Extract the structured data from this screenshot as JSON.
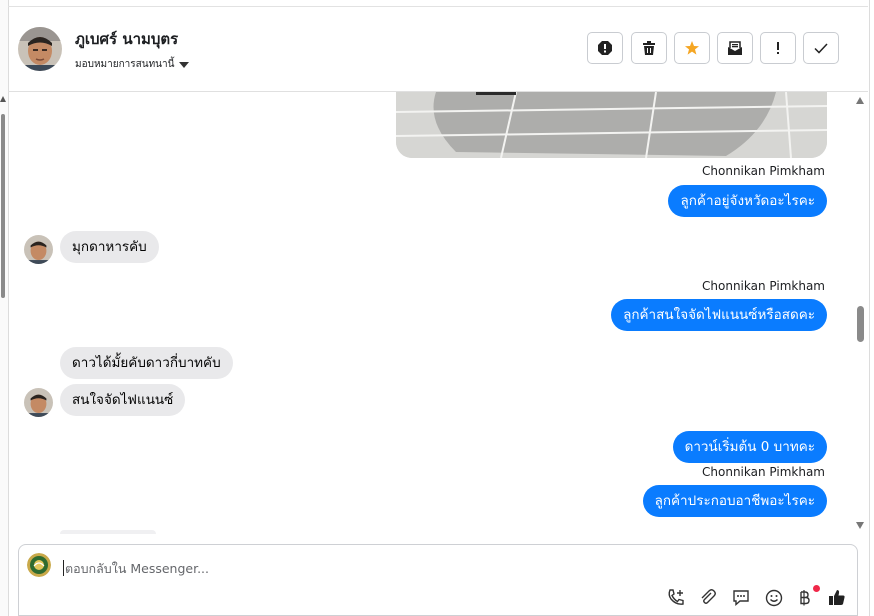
{
  "header": {
    "contact_name": "ภูเบศร์ นามบุตร",
    "assign_label": "มอบหมายการสนทนานี้"
  },
  "toolbar": {
    "buttons": [
      {
        "name": "report-icon"
      },
      {
        "name": "trash-icon"
      },
      {
        "name": "star-icon",
        "color": "#f5a623"
      },
      {
        "name": "mail-envelope-icon"
      },
      {
        "name": "exclamation-icon"
      },
      {
        "name": "checkmark-icon"
      }
    ]
  },
  "messages": [
    {
      "type": "image"
    },
    {
      "type": "outgoing",
      "sender": "Chonnikan Pimkham",
      "text": "ลูกค้าอยู่จังหวัดอะไรคะ"
    },
    {
      "type": "incoming",
      "text": "มุกดาหารคับ"
    },
    {
      "type": "outgoing",
      "sender": "Chonnikan Pimkham",
      "text": "ลูกค้าสนใจจัดไฟแนนซ์หรือสดคะ"
    },
    {
      "type": "incoming",
      "text": "ดาวได้มั้ยคับดาวกี่บาทคับ"
    },
    {
      "type": "incoming",
      "text": "สนใจจัดไฟแนนซ์"
    },
    {
      "type": "outgoing",
      "text": "ดาวน์เริ่มต้น 0 บาทคะ"
    },
    {
      "type": "outgoing",
      "sender": "Chonnikan Pimkham",
      "text": "ลูกค้าประกอบอาชีพอะไรคะ"
    }
  ],
  "composer": {
    "placeholder": "ตอบกลับใน Messenger...",
    "icons": [
      "phone-plus-icon",
      "paperclip-icon",
      "speech-bubble-icon",
      "emoji-icon",
      "baht-icon",
      "thumbs-up-icon"
    ],
    "notification_dot_color": "#f02849"
  },
  "colors": {
    "outgoing_bubble": "#0a7cff",
    "incoming_bubble": "#e9e9eb"
  }
}
